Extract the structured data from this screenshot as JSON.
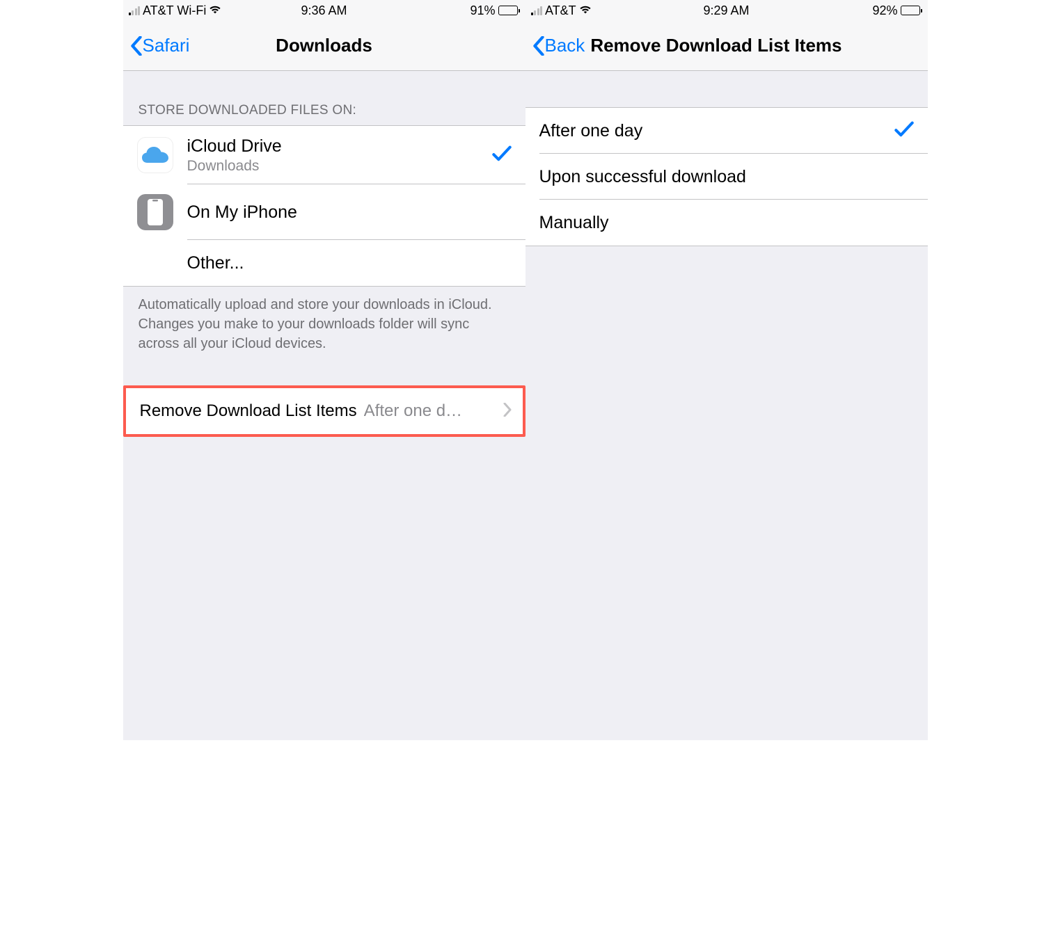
{
  "left": {
    "status": {
      "carrier": "AT&T Wi-Fi",
      "time": "9:36 AM",
      "battery_pct": "91%",
      "battery_fill": 91,
      "signal_active_bars": 1,
      "wifi": true
    },
    "nav": {
      "back_label": "Safari",
      "title": "Downloads"
    },
    "section_header": "STORE DOWNLOADED FILES ON:",
    "storage_options": [
      {
        "icon": "icloud",
        "title": "iCloud Drive",
        "subtitle": "Downloads",
        "selected": true
      },
      {
        "icon": "iphone",
        "title": "On My iPhone",
        "subtitle": "",
        "selected": false
      },
      {
        "icon": "",
        "title": "Other...",
        "subtitle": "",
        "selected": false
      }
    ],
    "footer": "Automatically upload and store your downloads in iCloud. Changes you make to your downloads folder will sync across all your iCloud devices.",
    "remove_row": {
      "label": "Remove Download List Items",
      "value": "After one d…"
    }
  },
  "right": {
    "status": {
      "carrier": "AT&T",
      "time": "9:29 AM",
      "battery_pct": "92%",
      "battery_fill": 92,
      "signal_active_bars": 1,
      "wifi": true
    },
    "nav": {
      "back_label": "Back",
      "title": "Remove Download List Items"
    },
    "options": [
      {
        "label": "After one day",
        "selected": true
      },
      {
        "label": "Upon successful download",
        "selected": false
      },
      {
        "label": "Manually",
        "selected": false
      }
    ]
  }
}
